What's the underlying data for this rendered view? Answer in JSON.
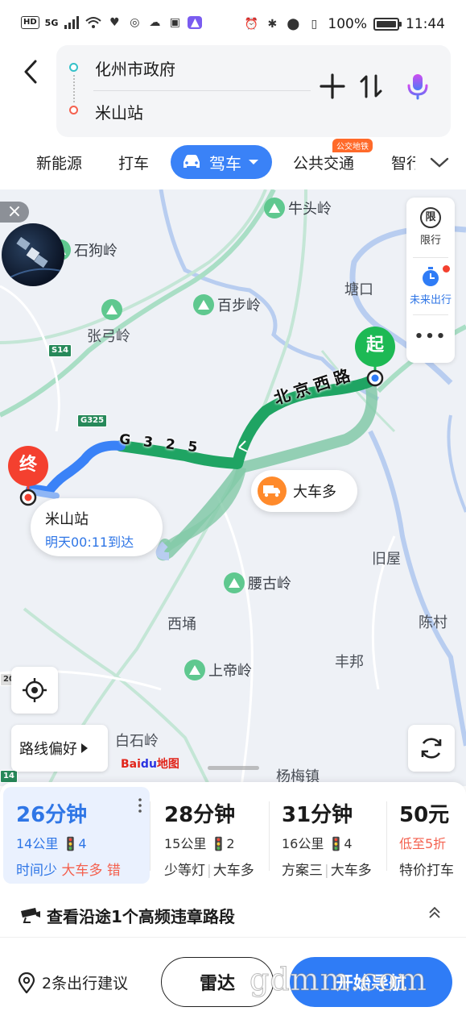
{
  "status_bar": {
    "left_badges": [
      "HD",
      "5G"
    ],
    "battery": "100%",
    "time": "11:44"
  },
  "search": {
    "origin": "化州市政府",
    "destination": "米山站"
  },
  "tabs": {
    "new_energy": "新能源",
    "taxi": "打车",
    "drive": "驾车",
    "transit": "公共交通",
    "transit_badge": "公交地铁",
    "more": "智行"
  },
  "map": {
    "places": {
      "niutouling": "牛头岭",
      "shigouling": "石狗岭",
      "tangkou": "塘口",
      "bubuling": "百步岭",
      "zhanggongling": "张弓岭",
      "jiuwu": "旧屋",
      "yaoguling": "腰古岭",
      "xiyong": "西埇",
      "chencun": "陈村",
      "fengbang": "丰邦",
      "shangdiling": "上帝岭",
      "baishiling": "白石岭",
      "yangmeizhen": "杨梅镇"
    },
    "road_signs": {
      "s14": "S14",
      "g325": "G325",
      "s14_bottom": "14",
      "left_20": "20"
    },
    "route_labels": {
      "beijing_west_road": "北京西路",
      "g325": "G325"
    },
    "start_marker": "起",
    "end_marker": "终",
    "destination_card": {
      "name": "米山站",
      "arrival": "明天00:11到达"
    },
    "traffic_tip": "大车多",
    "right_panel": {
      "restrict_icon_text": "限",
      "restrict_label": "限行",
      "future_label": "未来出行",
      "more": "•••"
    },
    "route_pref": "路线偏好",
    "logo_main": "Bai",
    "logo_du": "du",
    "logo_map": "地图"
  },
  "routes": [
    {
      "time": "26分钟",
      "distance": "14公里",
      "lights": "4",
      "tags": [
        "时间少",
        "大车多",
        "错"
      ]
    },
    {
      "time": "28分钟",
      "distance": "15公里",
      "lights": "2",
      "tags": [
        "少等灯",
        "大车多"
      ]
    },
    {
      "time": "31分钟",
      "distance": "16公里",
      "lights": "4",
      "tags": [
        "方案三",
        "大车多"
      ]
    },
    {
      "time": "50元",
      "distance": "低至5折",
      "lights": "",
      "tags": [
        "特价打车"
      ]
    }
  ],
  "violation_text": "查看沿途1个高频违章路段",
  "bottom": {
    "suggest": "2条出行建议",
    "radar": "雷达",
    "start": "开始导航",
    "watermark": "gdmm.com"
  },
  "colors": {
    "accent": "#2f76e6",
    "route_green": "#1fa463",
    "route_blue": "#3a82f7",
    "start_marker": "#1db954",
    "end_marker": "#f4402f"
  }
}
